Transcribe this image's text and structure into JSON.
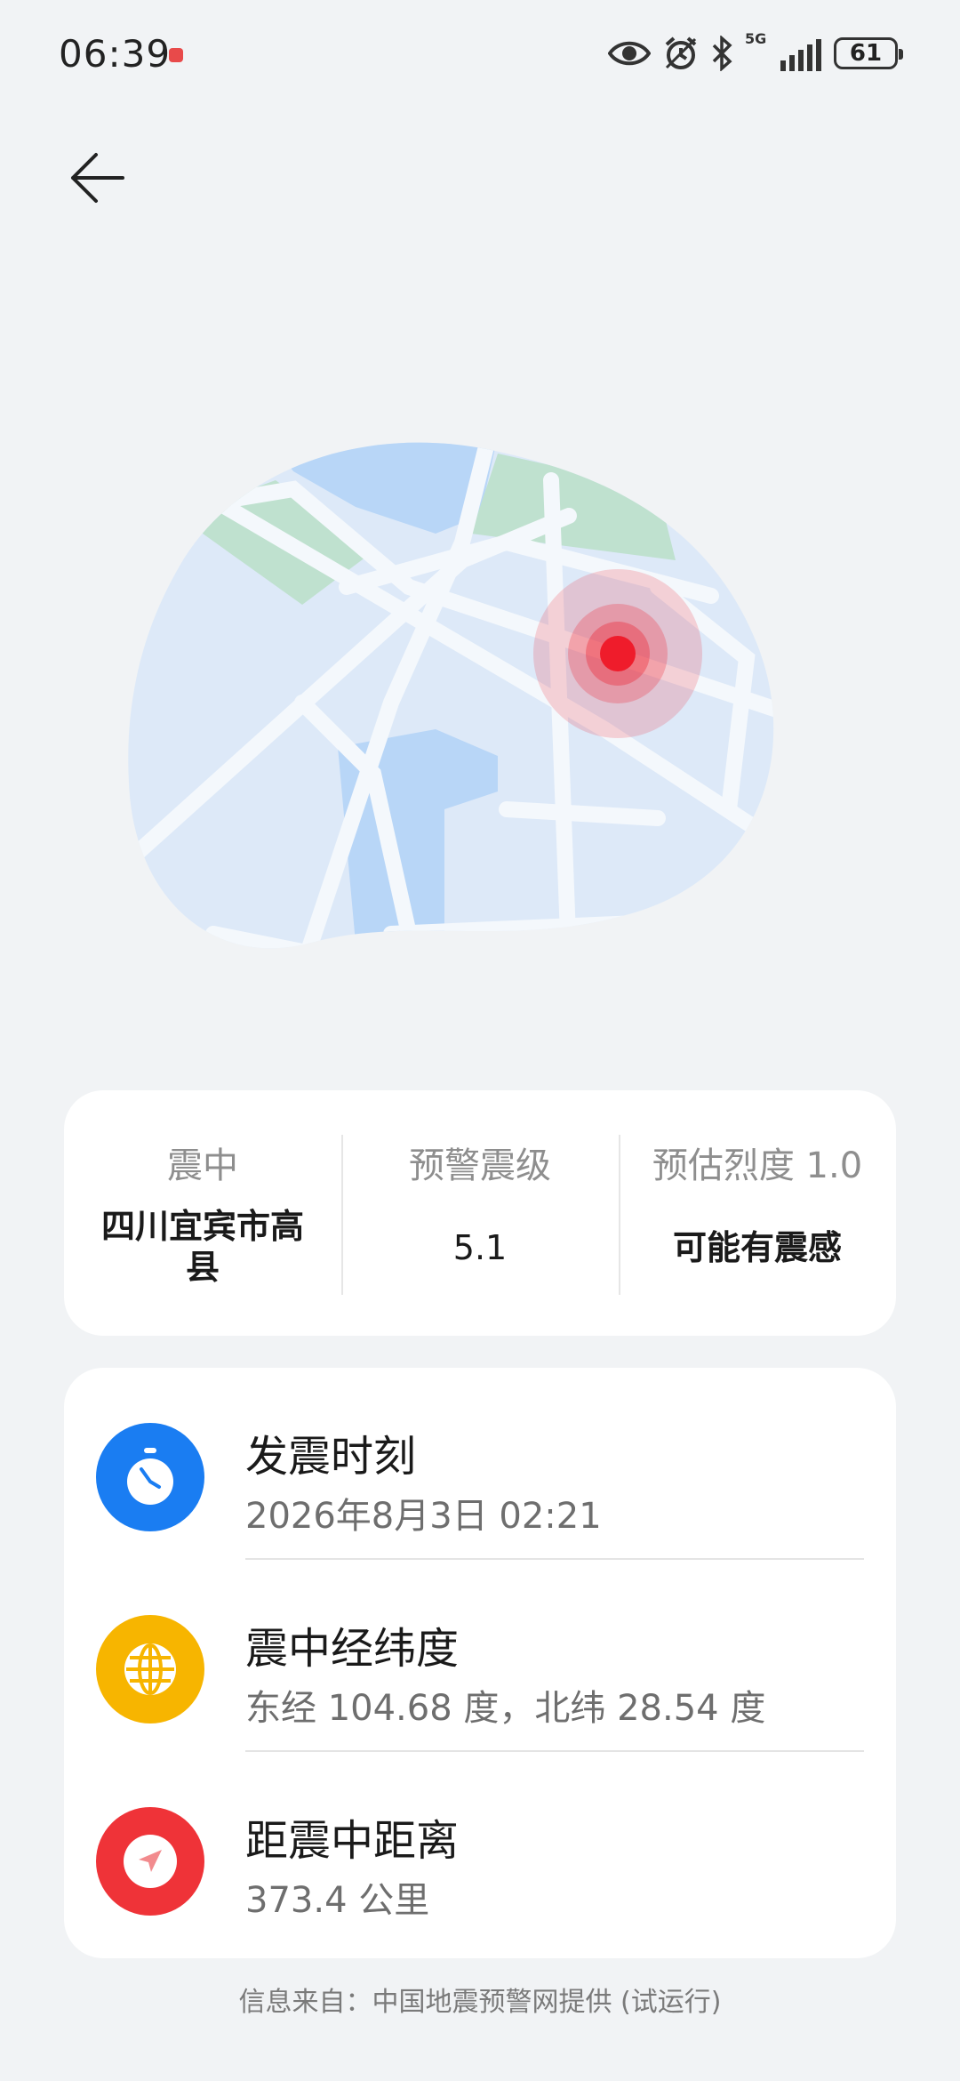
{
  "status_bar": {
    "time": "06:39",
    "network": "5G",
    "battery": "61",
    "icons": [
      "eye-icon",
      "alarm-icon",
      "bluetooth-icon",
      "signal-icon",
      "battery-icon"
    ]
  },
  "nav": {
    "back_icon": "arrow-left-icon"
  },
  "summary": {
    "epicenter_label": "震中",
    "epicenter_value": "四川宜宾市高县",
    "magnitude_label": "预警震级",
    "magnitude_value": "5.1",
    "intensity_label": "预估烈度 1.0",
    "intensity_value": "可能有震感"
  },
  "details": [
    {
      "icon": "clock-icon",
      "color": "#1a7df2",
      "title": "发震时刻",
      "subtitle": "2026年8月3日 02:21"
    },
    {
      "icon": "globe-icon",
      "color": "#f7b500",
      "title": "震中经纬度",
      "subtitle": "东经 104.68 度，北纬 28.54 度"
    },
    {
      "icon": "navigation-icon",
      "color": "#ef3338",
      "title": "距震中距离",
      "subtitle": "373.4 公里"
    }
  ],
  "footer": "信息来自：中国地震预警网提供 (试运行)",
  "colors": {
    "background": "#f1f3f5",
    "map_land": "#dde9f8",
    "map_water": "#b8d6f7",
    "map_park": "#bfe1cf",
    "epicenter": "#ef1c2b"
  }
}
